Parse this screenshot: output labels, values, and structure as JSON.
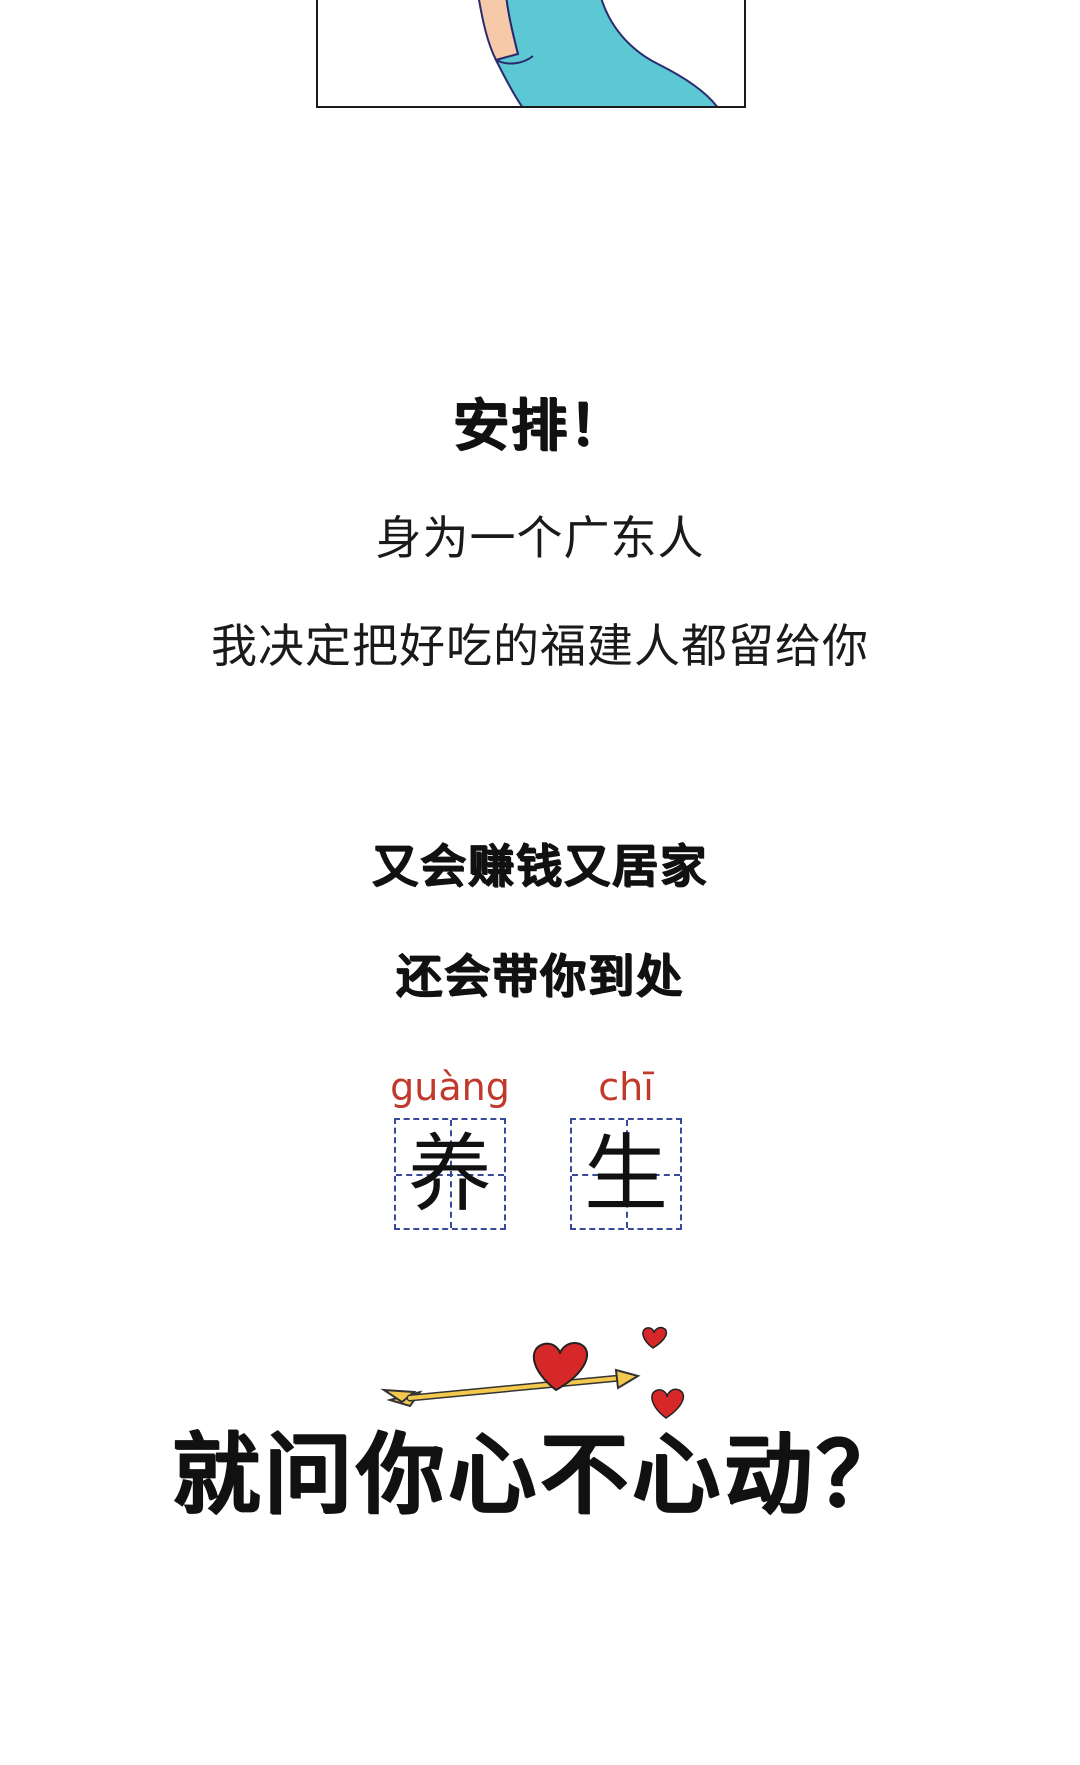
{
  "headline": "安排！",
  "intro": {
    "line1": "身为一个广东人",
    "line2": "我决定把好吃的福建人都留给你"
  },
  "subtitle": {
    "line1": "又会赚钱又居家",
    "line2": "还会带你到处"
  },
  "characters": [
    {
      "pinyin": "guàng",
      "hanzi": "养"
    },
    {
      "pinyin": "chī",
      "hanzi": "生"
    }
  ],
  "finale": "就问你心不心动？",
  "colors": {
    "pinyin": "#c0392b",
    "grid": "#3a4a9a",
    "heart": "#d62828",
    "arrow": "#f2c94c",
    "shirt": "#5bc8d4",
    "skin": "#f6c9a8"
  }
}
